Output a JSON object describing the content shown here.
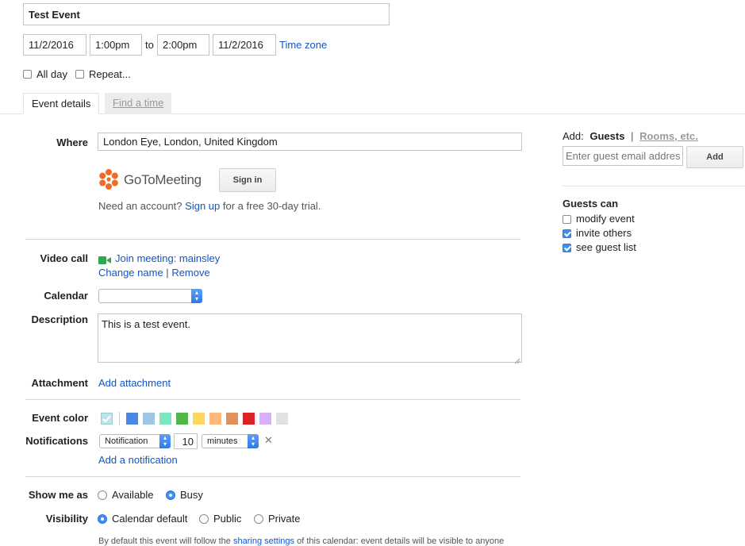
{
  "event": {
    "title": "Test Event",
    "start_date": "11/2/2016",
    "start_time": "1:00pm",
    "to_label": "to",
    "end_time": "2:00pm",
    "end_date": "11/2/2016",
    "time_zone_link": "Time zone",
    "all_day_label": "All day",
    "all_day_checked": false,
    "repeat_label": "Repeat...",
    "repeat_checked": false
  },
  "tabs": [
    {
      "label": "Event details",
      "active": true
    },
    {
      "label": "Find a time",
      "active": false
    }
  ],
  "details": {
    "where_label": "Where",
    "where_value": "London Eye, London, United Kingdom",
    "gotomeeting": {
      "logo_text": "GoToMeeting",
      "sign_in_label": "Sign in",
      "need_account_text": "Need an account?",
      "sign_up_link": "Sign up",
      "trial_text": "for a free 30-day trial."
    },
    "video_call_label": "Video call",
    "join_meeting_link": "Join meeting: mainsley",
    "change_name_link": "Change name",
    "separator": "|",
    "remove_link": "Remove",
    "calendar_label": "Calendar",
    "calendar_value": "",
    "description_label": "Description",
    "description_value": "This is a test event.",
    "attachment_label": "Attachment",
    "add_attachment_link": "Add attachment",
    "event_color_label": "Event color",
    "event_colors": [
      "#a4bdfc",
      "#4986e7",
      "#9fc6e7",
      "#7ae7bf",
      "#51b749",
      "#fbd75b",
      "#ffb878",
      "#e1925b",
      "#dc2127",
      "#dbadff",
      "#e1e1e1"
    ],
    "notifications_label": "Notifications",
    "notification_type": "Notification",
    "notification_amount": "10",
    "notification_unit": "minutes",
    "add_notification_link": "Add a notification",
    "show_me_as_label": "Show me as",
    "show_me_as_options": [
      {
        "label": "Available",
        "selected": false
      },
      {
        "label": "Busy",
        "selected": true
      }
    ],
    "visibility_label": "Visibility",
    "visibility_options": [
      {
        "label": "Calendar default",
        "selected": true
      },
      {
        "label": "Public",
        "selected": false
      },
      {
        "label": "Private",
        "selected": false
      }
    ],
    "footer_text_start": "By default this event will follow the",
    "footer_link": "sharing settings",
    "footer_text_end": "of this calendar: event details will be visible to anyone"
  },
  "guests": {
    "add_label": "Add:",
    "guests_tab": "Guests",
    "separator": "|",
    "rooms_tab": "Rooms, etc.",
    "email_placeholder": "Enter guest email addresses",
    "add_button": "Add",
    "guests_can_label": "Guests can",
    "permissions": [
      {
        "label": "modify event",
        "checked": false
      },
      {
        "label": "invite others",
        "checked": true
      },
      {
        "label": "see guest list",
        "checked": true
      }
    ]
  },
  "colors": {
    "link": "#1155cc",
    "accent_blue": "#3d8df5",
    "video_green": "#2fa84f",
    "gotomeeting_orange": "#f26b22"
  }
}
